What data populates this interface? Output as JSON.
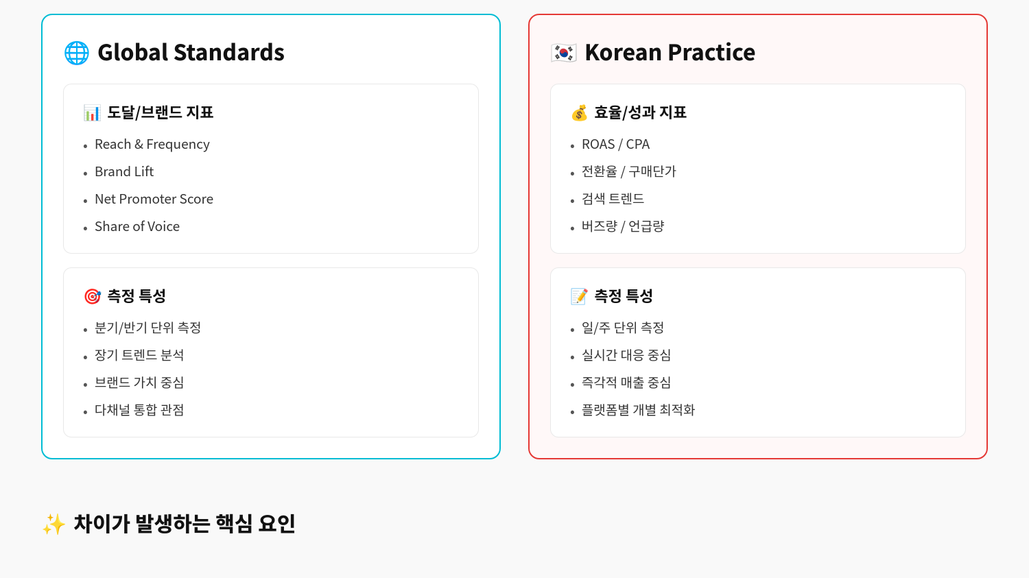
{
  "global": {
    "title_emoji": "🌐",
    "title": "Global Standards",
    "brand_section": {
      "title_emoji": "📊",
      "title": "도달/브랜드 지표",
      "items": [
        "Reach & Frequency",
        "Brand Lift",
        "Net Promoter Score",
        "Share of Voice"
      ]
    },
    "measurement_section": {
      "title_emoji": "🎯",
      "title": "측정 특성",
      "items": [
        "분기/반기 단위 측정",
        "장기 트렌드 분석",
        "브랜드 가치 중심",
        "다채널 통합 관점"
      ]
    }
  },
  "korean": {
    "title_emoji": "🇰🇷",
    "title": "Korean Practice",
    "performance_section": {
      "title_emoji": "💰",
      "title": "효율/성과 지표",
      "items": [
        "ROAS / CPA",
        "전환율 / 구매단가",
        "검색 트렌드",
        "버즈량 / 언급량"
      ]
    },
    "measurement_section": {
      "title_emoji": "📝",
      "title": "측정 특성",
      "items": [
        "일/주 단위 측정",
        "실시간 대응 중심",
        "즉각적 매출 중심",
        "플랫폼별 개별 최적화"
      ]
    }
  },
  "bottom": {
    "emoji": "✨",
    "title": "차이가 발생하는 핵심 요인"
  }
}
